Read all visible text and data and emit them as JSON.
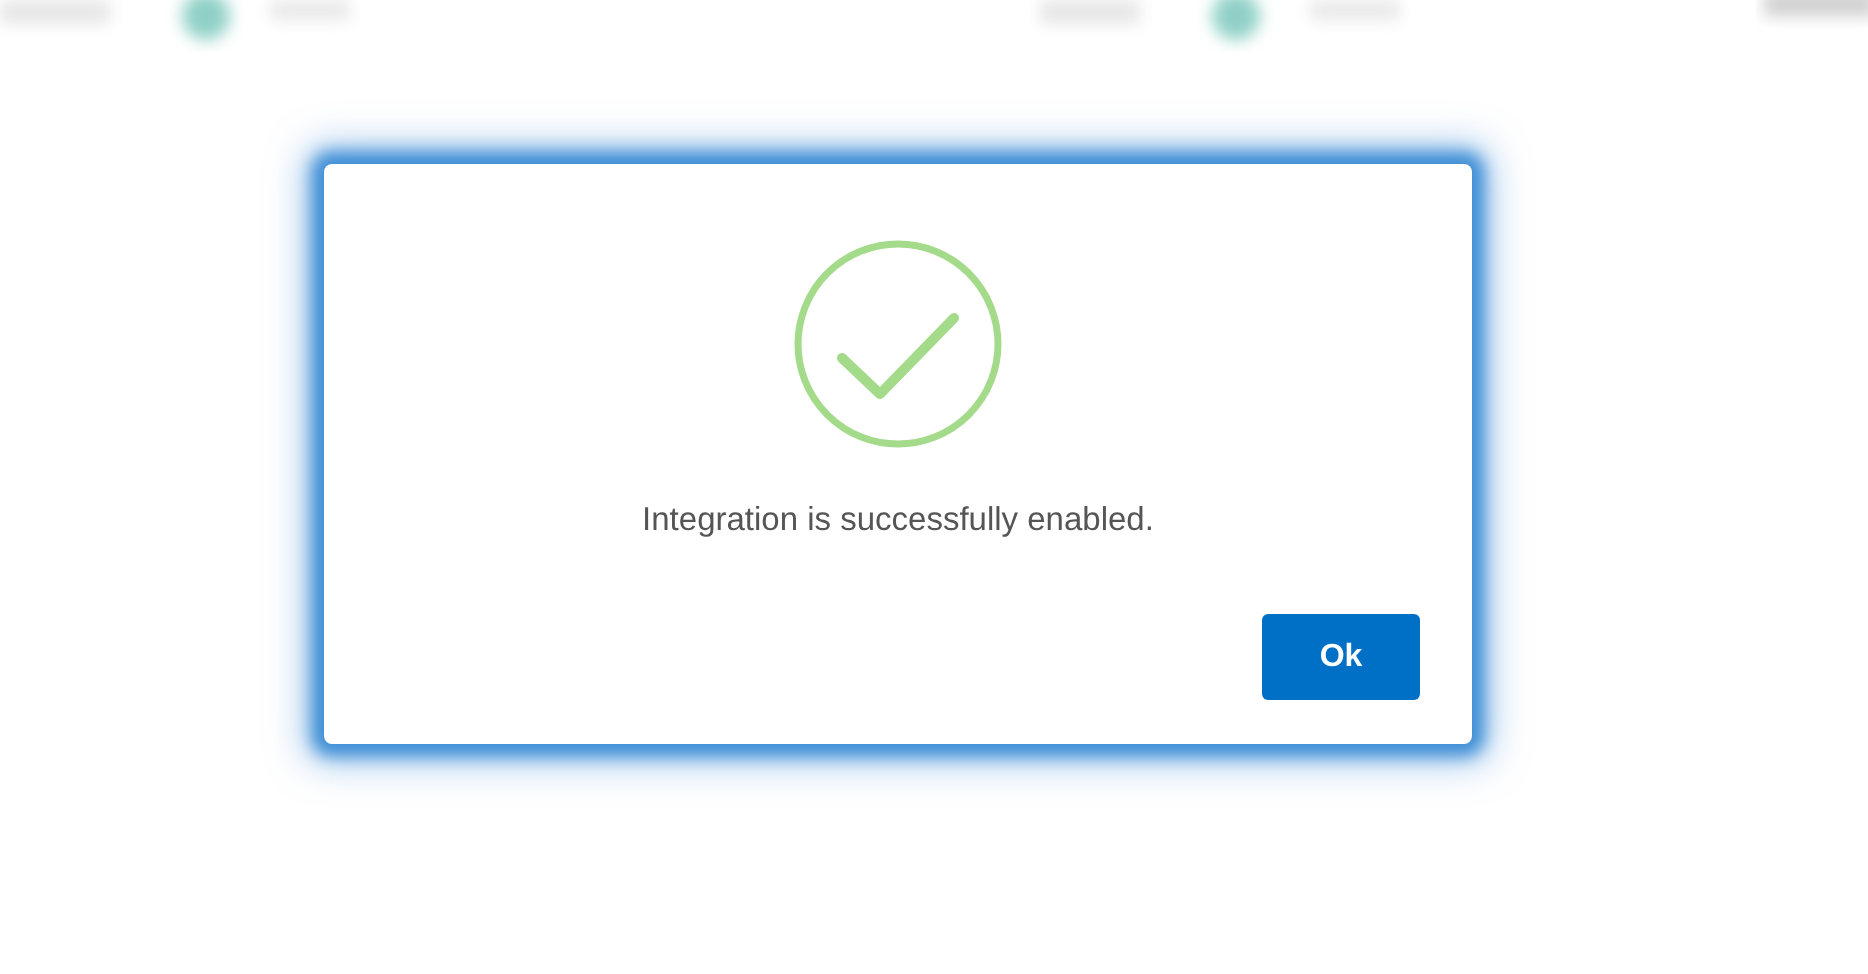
{
  "dialog": {
    "message": "Integration is successfully enabled.",
    "success": true,
    "buttons": [
      "Ok"
    ]
  }
}
